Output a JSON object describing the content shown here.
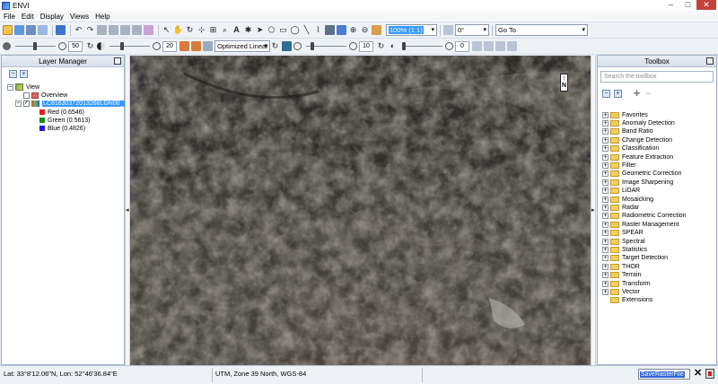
{
  "window": {
    "title": "ENVI",
    "minimize": "–",
    "maximize": "□",
    "close": "✕"
  },
  "menu": [
    "File",
    "Edit",
    "Display",
    "Views",
    "Help"
  ],
  "toolbar": {
    "zoom_combo": "100% (1:1)",
    "rotate_combo": "0°",
    "goto_combo": "Go To",
    "brightness_value": "50",
    "contrast_value": "20",
    "stretch_combo": "Optimized Linear",
    "sharpen_value": "10",
    "transparency_value": "0"
  },
  "layer_manager": {
    "title": "Layer Manager",
    "tree": {
      "view": "View",
      "overview": "Overview",
      "layer": "LC81630372013268LGN00_",
      "bands": [
        {
          "label": "Red (0.6546)",
          "color": "#e02020"
        },
        {
          "label": "Green (0.5613)",
          "color": "#1a8a1a"
        },
        {
          "label": "Blue (0.4826)",
          "color": "#1a1ad8"
        }
      ]
    }
  },
  "view": {
    "north_arrow": "N"
  },
  "toolbox": {
    "title": "Toolbox",
    "search_placeholder": "Search the toolbox",
    "items": [
      "Favorites",
      "Anomaly Detection",
      "Band Ratio",
      "Change Detection",
      "Classification",
      "Feature Extraction",
      "Filter",
      "Geometric Correction",
      "Image Sharpening",
      "LiDAR",
      "Mosaicking",
      "Radar",
      "Radiometric Correction",
      "Raster Management",
      "SPEAR",
      "Spectral",
      "Statistics",
      "Target Detection",
      "THOR",
      "Terrain",
      "Transform",
      "Vector",
      "Extensions"
    ]
  },
  "status": {
    "coords": "Lat: 33°8'12.06\"N, Lon: 52°46'36.84\"E",
    "projection": "UTM, Zone 39 North, WGS-84",
    "command": "SaveRasterFile"
  },
  "colors": {
    "selection": "#3399ff",
    "panel_border": "#9fb0c6",
    "terrain_dark": "#3f3b37"
  }
}
